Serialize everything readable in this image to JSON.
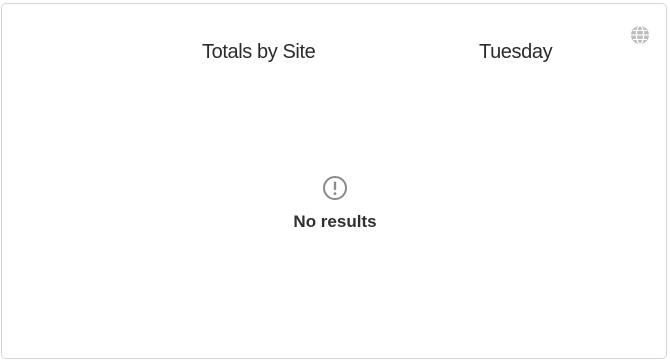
{
  "widget": {
    "title": "Totals by Site",
    "day": "Tuesday",
    "empty_message": "No results",
    "icons": {
      "top_right": "globe-icon",
      "empty_state": "alert-circle-icon"
    },
    "colors": {
      "icon_gray": "#bdbdbd",
      "text": "#2b2b2b",
      "border": "#d6d6d6"
    }
  }
}
